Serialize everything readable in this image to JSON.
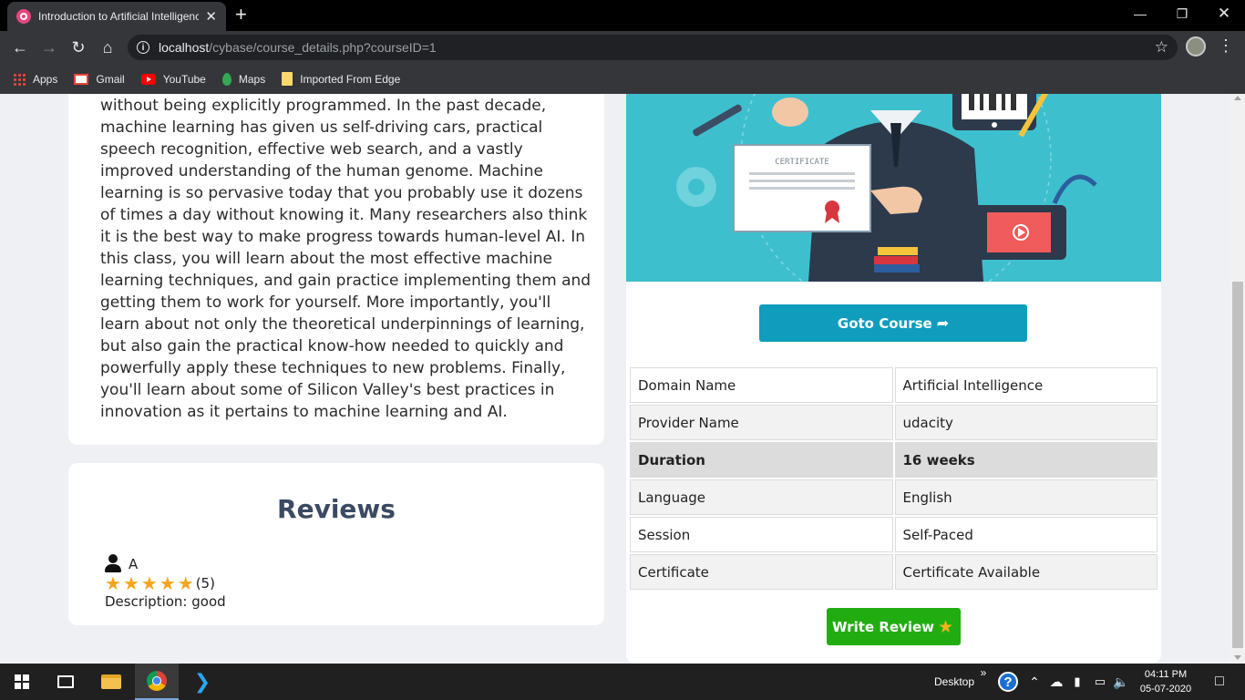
{
  "browser": {
    "tab_title": "Introduction to Artificial Intelligence",
    "tab_close": "✕",
    "new_tab": "+",
    "url_host": "localhost",
    "url_path": "/cybase/course_details.php?courseID=1",
    "bookmarks": [
      {
        "label": "Apps",
        "icon": "apps-grid-icon"
      },
      {
        "label": "Gmail",
        "icon": "gmail-icon"
      },
      {
        "label": "YouTube",
        "icon": "youtube-icon"
      },
      {
        "label": "Maps",
        "icon": "maps-icon"
      },
      {
        "label": "Imported From Edge",
        "icon": "folder-icon"
      }
    ]
  },
  "course": {
    "description": "without being explicitly programmed. In the past decade, machine learning has given us self-driving cars, practical speech recognition, effective web search, and a vastly improved understanding of the human genome. Machine learning is so pervasive today that you probably use it dozens of times a day without knowing it. Many researchers also think it is the best way to make progress towards human-level AI. In this class, you will learn about the most effective machine learning techniques, and gain practice implementing them and getting them to work for yourself. More importantly, you'll learn about not only the theoretical underpinnings of learning, but also gain the practical know-how needed to quickly and powerfully apply these techniques to new problems. Finally, you'll learn about some of Silicon Valley's best practices in innovation as it pertains to machine learning and AI.",
    "banner": {
      "certificate_label": "CERTIFICATE"
    },
    "goto_button": "Goto Course",
    "details": [
      {
        "label": "Domain Name",
        "value": "Artificial Intelligence"
      },
      {
        "label": "Provider Name",
        "value": "udacity"
      },
      {
        "label": "Duration",
        "value": "16 weeks"
      },
      {
        "label": "Language",
        "value": "English"
      },
      {
        "label": "Session",
        "value": "Self-Paced"
      },
      {
        "label": "Certificate",
        "value": "Certificate Available"
      }
    ],
    "write_review_button": "Write Review"
  },
  "reviews": {
    "title": "Reviews",
    "items": [
      {
        "user": "A",
        "rating": 5,
        "rating_text": "(5)",
        "description": "Description: good"
      }
    ]
  },
  "taskbar": {
    "desktop_label": "Desktop",
    "chevron": "»",
    "time": "04:11 PM",
    "date": "05-07-2020"
  },
  "colors": {
    "accent_blue": "#0f9cbd",
    "accent_green": "#21ad12",
    "star": "#f5a51d",
    "banner_bg": "#3ebfce"
  }
}
